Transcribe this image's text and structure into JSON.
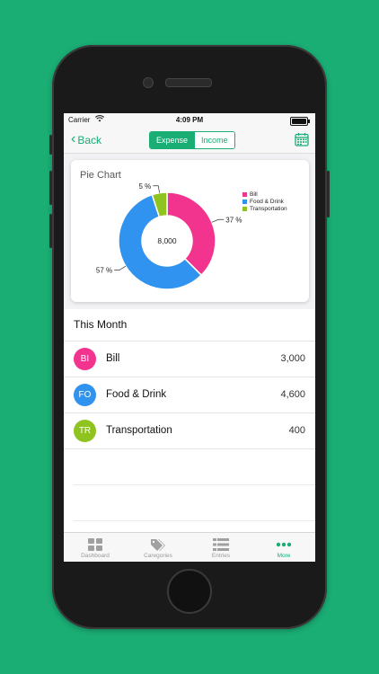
{
  "status_bar": {
    "carrier": "Carrier",
    "time": "4:09 PM"
  },
  "nav": {
    "back_label": "Back",
    "segments": [
      "Expense",
      "Income"
    ],
    "active_segment": "Expense"
  },
  "card": {
    "title": "Pie Chart"
  },
  "chart_data": {
    "type": "pie",
    "center_label": "8,000",
    "categories": [
      "Bill",
      "Food & Drink",
      "Transportation"
    ],
    "values": [
      3000,
      4600,
      400
    ],
    "percent_labels": [
      "37 %",
      "57 %",
      "5 %"
    ],
    "colors": [
      "#f2348f",
      "#2f93ef",
      "#8fc31f"
    ],
    "legend_position": "top-right"
  },
  "section": {
    "title": "This Month"
  },
  "rows": [
    {
      "initials": "BI",
      "name": "Bill",
      "amount": "3,000",
      "color": "#f2348f"
    },
    {
      "initials": "FO",
      "name": "Food & Drink",
      "amount": "4,600",
      "color": "#2f93ef"
    },
    {
      "initials": "TR",
      "name": "Transportation",
      "amount": "400",
      "color": "#8fc31f"
    }
  ],
  "tabs": [
    {
      "label": "Dashboard",
      "icon": "dashboard-icon"
    },
    {
      "label": "Caregories",
      "icon": "tag-icon"
    },
    {
      "label": "Entries",
      "icon": "list-icon"
    },
    {
      "label": "More",
      "icon": "more-icon"
    }
  ],
  "active_tab": "More",
  "colors": {
    "accent": "#1aad74",
    "background": "#1aad74"
  }
}
